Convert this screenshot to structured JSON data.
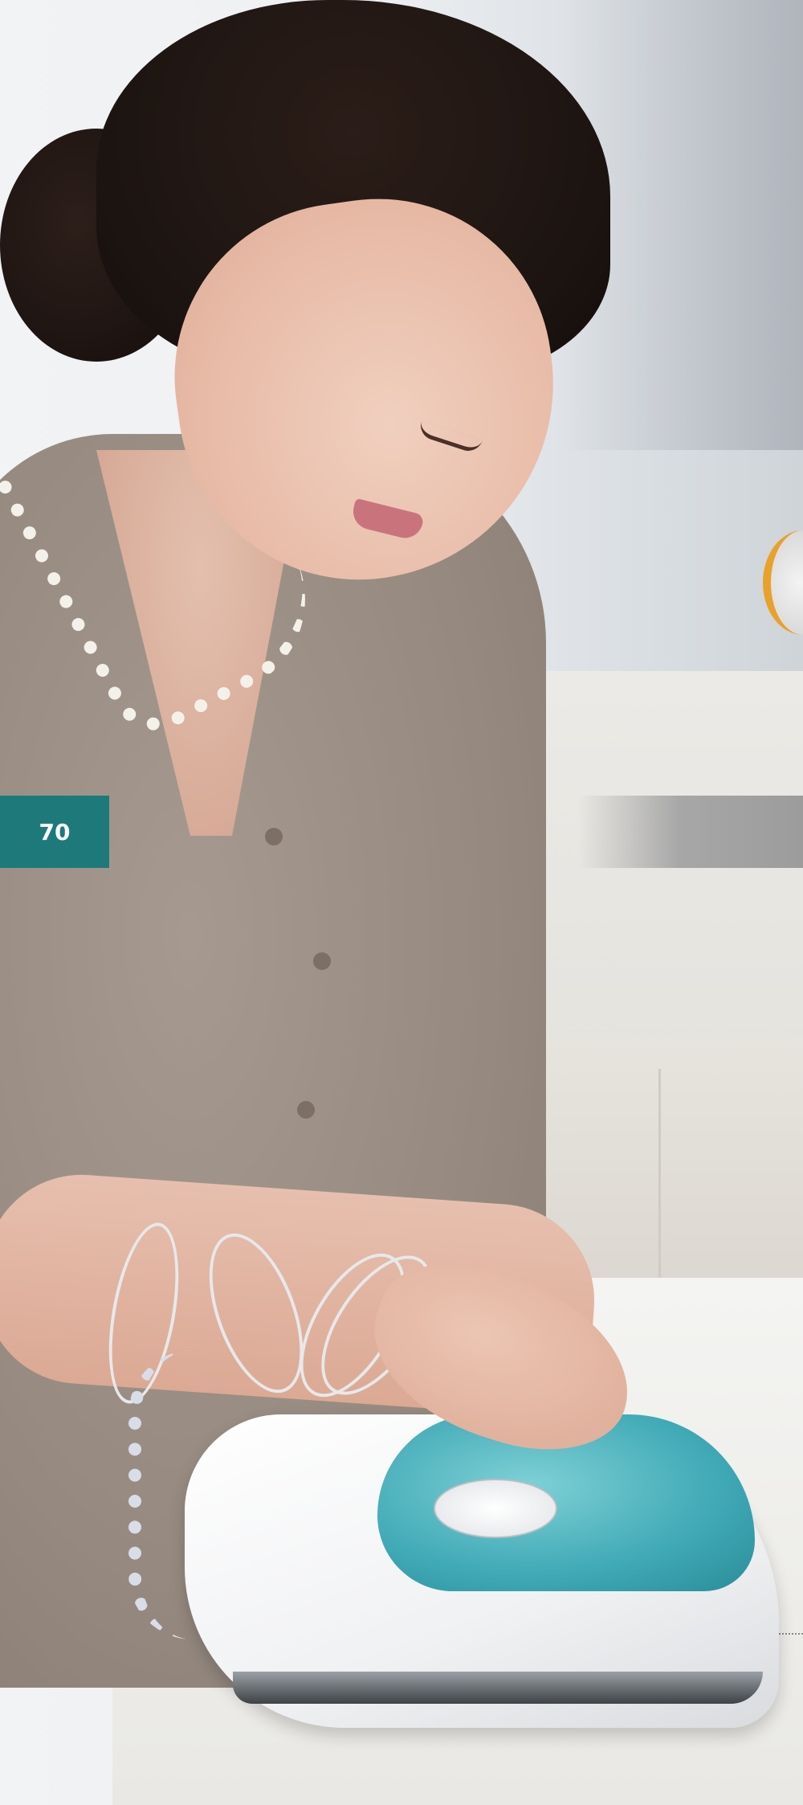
{
  "page": {
    "number": "70",
    "accent_color": "#1e7a7a"
  },
  "photo": {
    "icons": [
      "woman-ironing-photo",
      "steam-iron-icon",
      "fabric-shaver-icon"
    ]
  }
}
